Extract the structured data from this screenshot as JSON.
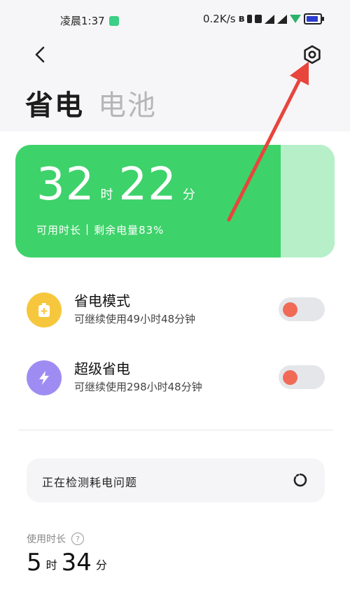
{
  "status_bar": {
    "time": "凌晨1:37",
    "network_speed": "0.2K/s"
  },
  "header": {
    "title": "省电",
    "tab_battery": "电池"
  },
  "battery_card": {
    "hours": "32",
    "hours_unit": "时",
    "minutes": "22",
    "minutes_unit": "分",
    "available_label": "可用时长",
    "separator": "|",
    "remaining_label": "剩余电量83%",
    "remaining_percent": 83,
    "colors": {
      "main": "#3ed26a",
      "extra": "#b7efc9"
    }
  },
  "modes": [
    {
      "title": "省电模式",
      "desc": "可继续使用49小时48分钟",
      "icon": "battery-plus-icon",
      "color": "#f6c73d",
      "enabled": false
    },
    {
      "title": "超级省电",
      "desc": "可继续使用298小时48分钟",
      "icon": "lightning-icon",
      "color": "#9f8cf3",
      "enabled": false
    }
  ],
  "detect": {
    "text": "正在检测耗电问题"
  },
  "usage": {
    "label": "使用时长",
    "hours": "5",
    "hours_unit": "时",
    "minutes": "34",
    "minutes_unit": "分"
  },
  "accent": {
    "arrow": "#e8453c",
    "toggle_knob": "#f16a56",
    "toggle_track": "#e4e6ea"
  }
}
